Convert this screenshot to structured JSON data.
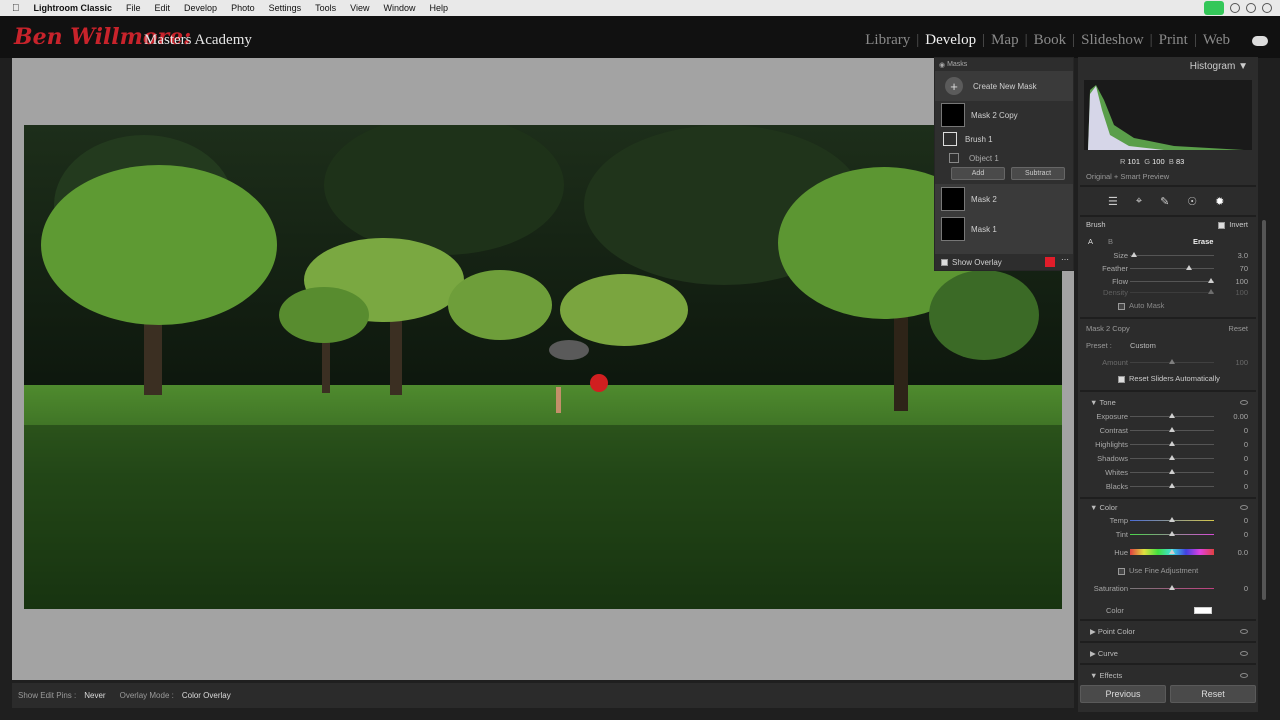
{
  "menubar": {
    "app": "Lightroom Classic",
    "items": [
      "File",
      "Edit",
      "Develop",
      "Photo",
      "Settings",
      "Tools",
      "View",
      "Window",
      "Help"
    ]
  },
  "header": {
    "logo": "Ben Willmore:",
    "logo_sub": "Masters Academy",
    "modules": [
      "Library",
      "Develop",
      "Map",
      "Book",
      "Slideshow",
      "Print",
      "Web"
    ],
    "active_module": "Develop"
  },
  "toolbar": {
    "edit_pins_label": "Show Edit Pins :",
    "edit_pins_value": "Never",
    "overlay_label": "Overlay Mode :",
    "overlay_value": "Color Overlay"
  },
  "masks": {
    "title": "Masks",
    "create": "Create New Mask",
    "items": [
      {
        "name": "Mask 2 Copy"
      },
      {
        "name": "Brush 1"
      },
      {
        "name": "Object 1"
      },
      {
        "name": "Mask 2"
      },
      {
        "name": "Mask 1"
      }
    ],
    "add": "Add",
    "subtract": "Subtract",
    "show_overlay": "Show Overlay",
    "overlay_color": "#e11d2a"
  },
  "histogram": {
    "title": "Histogram",
    "r_label": "R",
    "r": "101",
    "g_label": "G",
    "g": "100",
    "b_label": "B",
    "b": "83",
    "preview": "Original + Smart Preview"
  },
  "brush": {
    "label": "Brush",
    "invert": "Invert",
    "a": "A",
    "b": "B",
    "mode": "Erase",
    "sliders": [
      {
        "label": "Size",
        "value": "3.0",
        "pos": 0.05
      },
      {
        "label": "Feather",
        "value": "70",
        "pos": 0.7
      },
      {
        "label": "Flow",
        "value": "100",
        "pos": 0.97
      },
      {
        "label": "Density",
        "value": "100",
        "pos": 0.97
      }
    ],
    "auto_mask": "Auto Mask"
  },
  "mask_settings": {
    "name": "Mask 2 Copy",
    "reset": "Reset",
    "preset_label": "Preset :",
    "preset_value": "Custom",
    "amount_label": "Amount",
    "amount_value": "100",
    "reset_sliders": "Reset Sliders Automatically"
  },
  "tone": {
    "title": "Tone",
    "sliders": [
      {
        "label": "Exposure",
        "value": "0.00"
      },
      {
        "label": "Contrast",
        "value": "0"
      },
      {
        "label": "Highlights",
        "value": "0"
      },
      {
        "label": "Shadows",
        "value": "0"
      },
      {
        "label": "Whites",
        "value": "0"
      },
      {
        "label": "Blacks",
        "value": "0"
      }
    ]
  },
  "color": {
    "title": "Color",
    "sliders": [
      {
        "label": "Temp",
        "value": "0"
      },
      {
        "label": "Tint",
        "value": "0"
      }
    ],
    "hue_label": "Hue",
    "hue_value": "0.0",
    "fine": "Use Fine Adjustment",
    "sat_label": "Saturation",
    "sat_value": "0",
    "color_label": "Color"
  },
  "collapsed": [
    "Point Color",
    "Curve",
    "Effects"
  ],
  "buttons": {
    "previous": "Previous",
    "reset": "Reset"
  }
}
